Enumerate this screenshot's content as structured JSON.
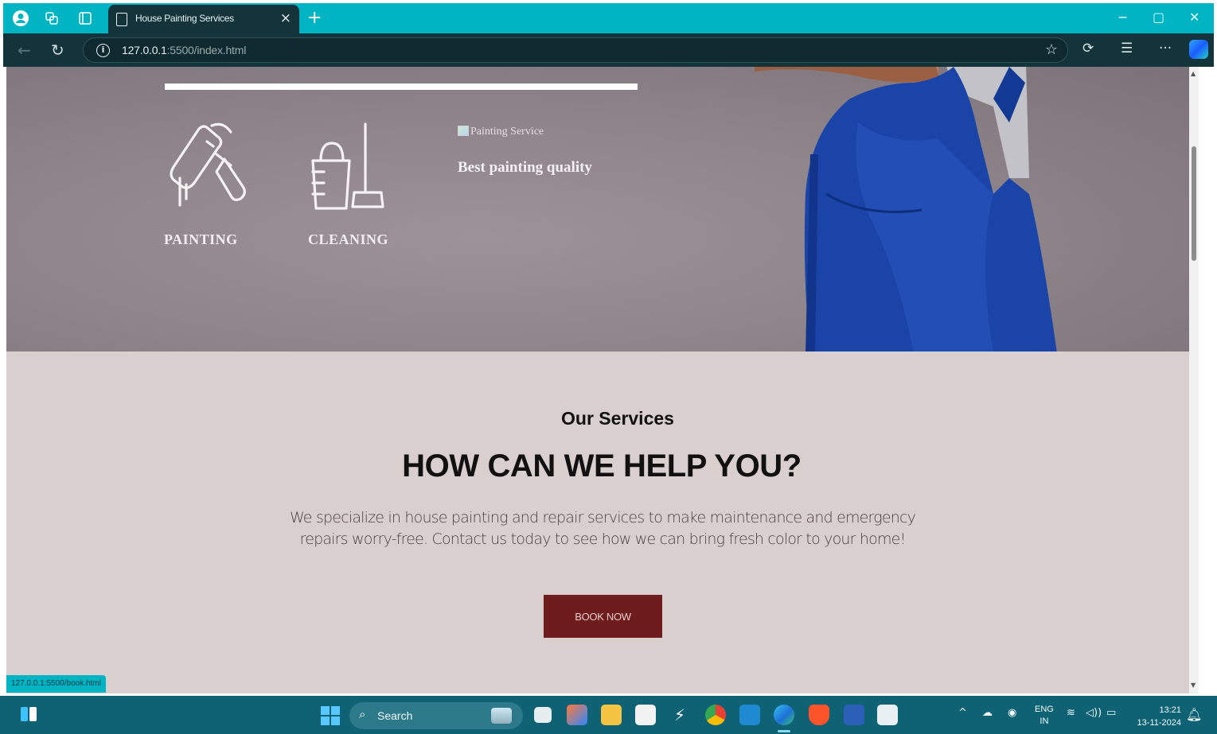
{
  "browser": {
    "tab_title": "House Painting Services",
    "tab_close": "×",
    "new_tab": "+",
    "url_host": "127.0.0.1",
    "url_rest": ":5500/index.html",
    "window_controls": {
      "minimize": "−",
      "maximize": "▢",
      "close": "✕"
    }
  },
  "hero": {
    "services": [
      {
        "label": "PAINTING",
        "icon": "paint-roller-icon"
      },
      {
        "label": "CLEANING",
        "icon": "bucket-mop-icon"
      }
    ],
    "image_alt": "Painting Service",
    "caption": "Best painting quality"
  },
  "services_section": {
    "kicker": "Our Services",
    "heading": "HOW CAN WE HELP YOU?",
    "description": "We specialize in house painting and repair services to make maintenance and emergency repairs worry-free. Contact us today to see how we can bring fresh color to your home!",
    "book_button": "BOOK NOW"
  },
  "status_bar": {
    "link_preview": "127.0.0.1:5500/book.html"
  },
  "taskbar": {
    "search_label": "Search",
    "language": "ENG",
    "region": "IN",
    "time": "13:21",
    "date": "13-11-2024"
  },
  "colors": {
    "title_bar": "#00b4c4",
    "toolbar": "#12343a",
    "page_background": "#dacfcf",
    "book_button": "#6e1c1c",
    "taskbar": "#0f6273"
  }
}
